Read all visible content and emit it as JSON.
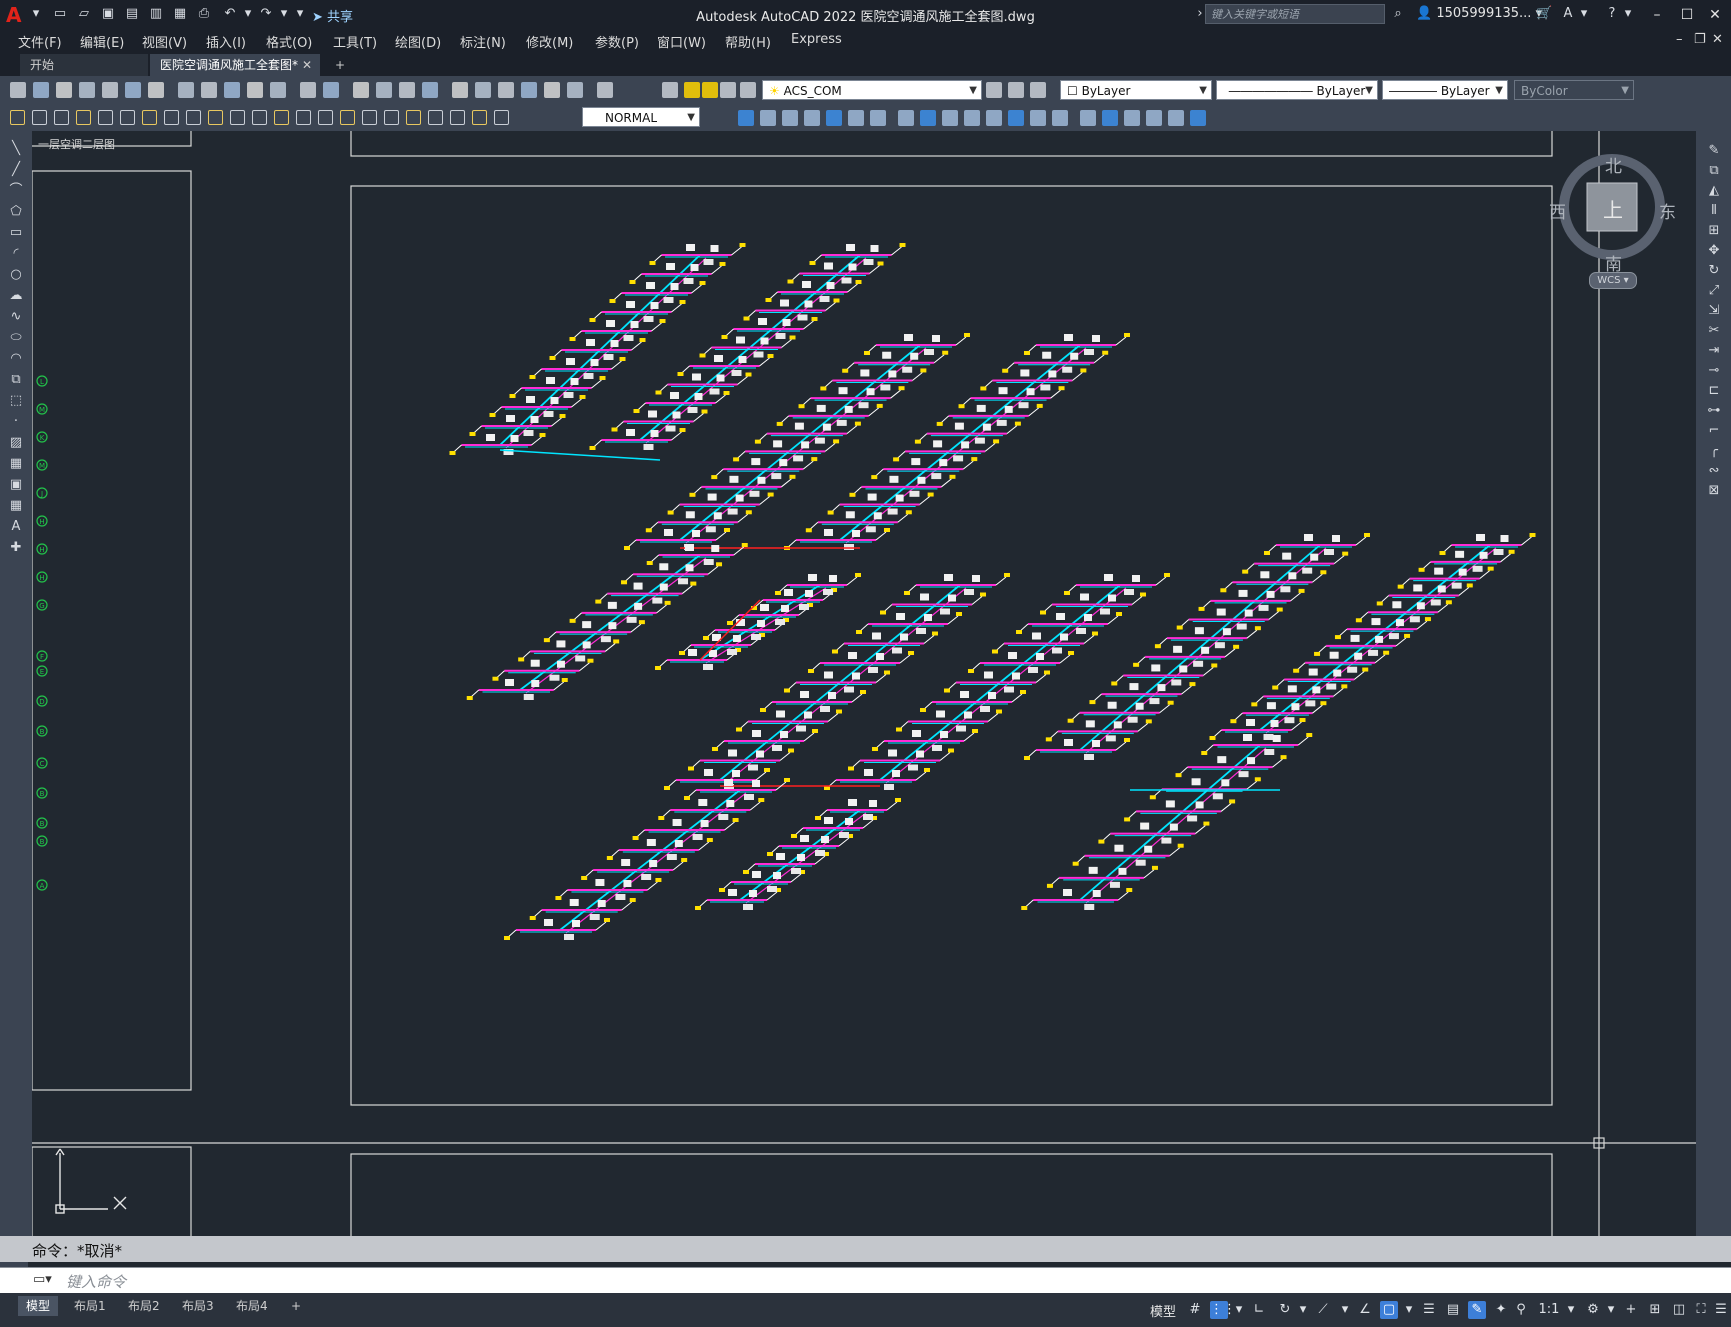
{
  "app": {
    "title": "Autodesk AutoCAD 2022    医院空调通风施工全套图.dwg",
    "share_label": "共享",
    "search_placeholder": "键入关键字或短语",
    "user_name": "1505999135...",
    "logo_letter": "A"
  },
  "menu": [
    "文件(F)",
    "编辑(E)",
    "视图(V)",
    "插入(I)",
    "格式(O)",
    "工具(T)",
    "绘图(D)",
    "标注(N)",
    "修改(M)",
    "参数(P)",
    "窗口(W)",
    "帮助(H)",
    "Express"
  ],
  "tabs": {
    "start": "开始",
    "active": "医院空调通风施工全套图*",
    "close": "✕",
    "add": "+"
  },
  "toolbar": {
    "layer": "ACS_COM",
    "color": "ByLayer",
    "linetype": "ByLayer",
    "lineweight": "ByLayer",
    "plotstyle": "ByColor",
    "textstyle": "NORMAL"
  },
  "viewcube": {
    "north": "北",
    "south": "南",
    "east": "东",
    "west": "西",
    "face": "上",
    "ucs": "WCS"
  },
  "grid_bubbles": [
    "L",
    "M",
    "K",
    "M",
    "J",
    "H",
    "H",
    "H",
    "G",
    "F",
    "E",
    "D",
    "B",
    "C",
    "B",
    "B",
    "B",
    "A"
  ],
  "partial_label": "一层空调二层图",
  "command": {
    "history": "命令：*取消*",
    "placeholder": "键入命令"
  },
  "layouts": [
    "模型",
    "布局1",
    "布局2",
    "布局3",
    "布局4",
    "+"
  ],
  "status": {
    "modelspace": "模型",
    "scale": "1:1"
  },
  "colors": {
    "canvas": "#212830",
    "duct_cyan": "#00e5ff",
    "duct_magenta": "#ff2bd6",
    "duct_red": "#ff2020",
    "accent_yellow": "#ffe000",
    "bubble_green": "#22c24a"
  }
}
